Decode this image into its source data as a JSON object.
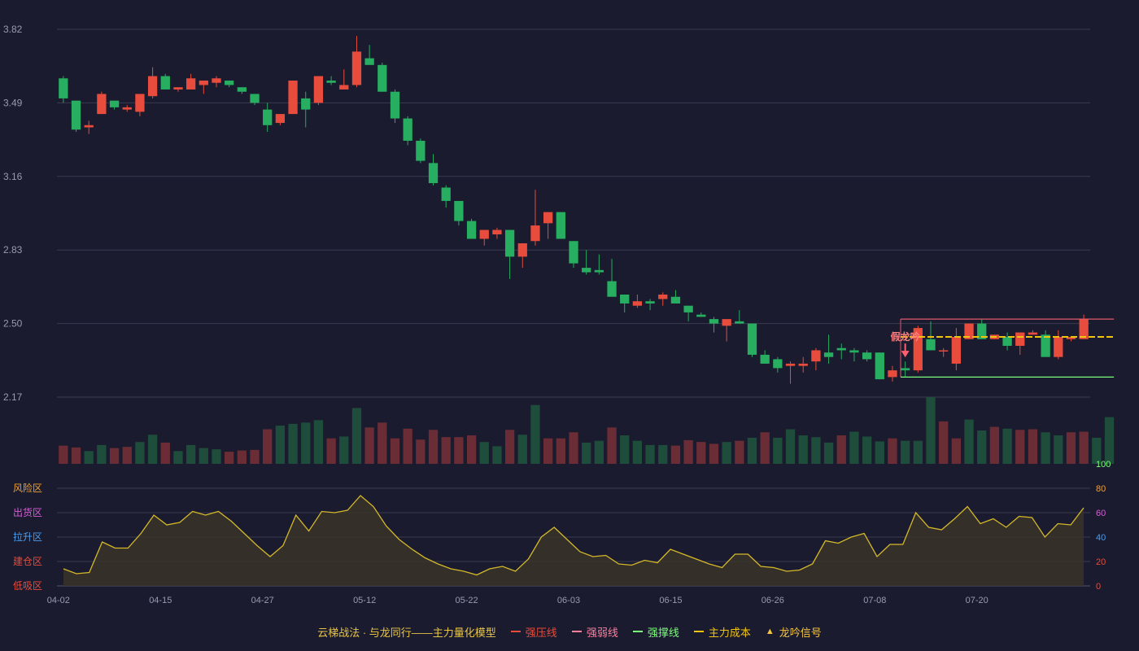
{
  "legend": {
    "title": "云梯战法 · 与龙同行——主力量化模型",
    "items": [
      {
        "label": "强压线",
        "color": "#e74c3c",
        "style": "solid"
      },
      {
        "label": "强弱线",
        "color": "#ff7f9e",
        "style": "dashed"
      },
      {
        "label": "强撑线",
        "color": "#7cfc7c",
        "style": "solid"
      },
      {
        "label": "主力成本",
        "color": "#f1c40f",
        "style": "dashed"
      },
      {
        "label": "龙吟信号",
        "color": "#f5c542",
        "style": "triangle",
        "glyph": "▲"
      }
    ]
  },
  "colors": {
    "background": "#1a1b2e",
    "grid": "#3a3b50",
    "up": "#e74c3c",
    "down": "#27ae60",
    "up_volume": "#6b2d35",
    "down_volume": "#1f4d3c",
    "indicator_line": "#d4b82a",
    "indicator_fill": "#3a3428"
  },
  "chart_data": [
    {
      "type": "candlestick",
      "y_ticks": [
        "3.82",
        "3.49",
        "3.16",
        "2.83",
        "2.50",
        "2.17"
      ],
      "ylim": [
        2.17,
        3.82
      ],
      "x_tick_labels": [
        {
          "index": 0,
          "label": "04-02"
        },
        {
          "index": 8,
          "label": "04-15"
        },
        {
          "index": 16,
          "label": "04-27"
        },
        {
          "index": 24,
          "label": "05-12"
        },
        {
          "index": 32,
          "label": "05-22"
        },
        {
          "index": 40,
          "label": "06-03"
        },
        {
          "index": 48,
          "label": "06-15"
        },
        {
          "index": 56,
          "label": "06-26"
        },
        {
          "index": 64,
          "label": "07-08"
        },
        {
          "index": 72,
          "label": "07-20"
        }
      ],
      "ohlc": [
        [
          3.6,
          3.61,
          3.49,
          3.51
        ],
        [
          3.5,
          3.5,
          3.36,
          3.37
        ],
        [
          3.38,
          3.41,
          3.35,
          3.39
        ],
        [
          3.44,
          3.54,
          3.44,
          3.53
        ],
        [
          3.5,
          3.5,
          3.46,
          3.47
        ],
        [
          3.46,
          3.48,
          3.45,
          3.47
        ],
        [
          3.45,
          3.53,
          3.43,
          3.53
        ],
        [
          3.52,
          3.65,
          3.51,
          3.61
        ],
        [
          3.61,
          3.62,
          3.55,
          3.55
        ],
        [
          3.55,
          3.56,
          3.54,
          3.56
        ],
        [
          3.55,
          3.62,
          3.55,
          3.6
        ],
        [
          3.57,
          3.59,
          3.53,
          3.59
        ],
        [
          3.58,
          3.61,
          3.56,
          3.6
        ],
        [
          3.59,
          3.59,
          3.56,
          3.57
        ],
        [
          3.56,
          3.56,
          3.53,
          3.54
        ],
        [
          3.53,
          3.53,
          3.48,
          3.49
        ],
        [
          3.46,
          3.49,
          3.36,
          3.39
        ],
        [
          3.4,
          3.43,
          3.39,
          3.44
        ],
        [
          3.44,
          3.56,
          3.44,
          3.59
        ],
        [
          3.51,
          3.54,
          3.38,
          3.46
        ],
        [
          3.49,
          3.61,
          3.48,
          3.61
        ],
        [
          3.59,
          3.61,
          3.57,
          3.58
        ],
        [
          3.55,
          3.64,
          3.55,
          3.57
        ],
        [
          3.57,
          3.79,
          3.56,
          3.72
        ],
        [
          3.69,
          3.75,
          3.68,
          3.66
        ],
        [
          3.66,
          3.67,
          3.54,
          3.54
        ],
        [
          3.54,
          3.55,
          3.4,
          3.42
        ],
        [
          3.42,
          3.43,
          3.3,
          3.32
        ],
        [
          3.32,
          3.33,
          3.22,
          3.23
        ],
        [
          3.22,
          3.26,
          3.12,
          3.13
        ],
        [
          3.11,
          3.12,
          3.02,
          3.05
        ],
        [
          3.05,
          3.05,
          2.94,
          2.96
        ],
        [
          2.96,
          2.97,
          2.88,
          2.88
        ],
        [
          2.88,
          2.89,
          2.85,
          2.92
        ],
        [
          2.9,
          2.93,
          2.88,
          2.92
        ],
        [
          2.92,
          2.92,
          2.7,
          2.8
        ],
        [
          2.8,
          2.82,
          2.75,
          2.86
        ],
        [
          2.87,
          3.1,
          2.85,
          2.94
        ],
        [
          2.95,
          3.0,
          2.88,
          3.0
        ],
        [
          3.0,
          3.0,
          2.88,
          2.88
        ],
        [
          2.87,
          2.87,
          2.75,
          2.77
        ],
        [
          2.75,
          2.83,
          2.72,
          2.73
        ],
        [
          2.74,
          2.81,
          2.72,
          2.73
        ],
        [
          2.69,
          2.79,
          2.63,
          2.62
        ],
        [
          2.63,
          2.63,
          2.55,
          2.59
        ],
        [
          2.58,
          2.63,
          2.57,
          2.6
        ],
        [
          2.6,
          2.61,
          2.56,
          2.59
        ],
        [
          2.61,
          2.64,
          2.58,
          2.63
        ],
        [
          2.62,
          2.65,
          2.59,
          2.59
        ],
        [
          2.58,
          2.58,
          2.51,
          2.55
        ],
        [
          2.54,
          2.55,
          2.53,
          2.53
        ],
        [
          2.52,
          2.53,
          2.46,
          2.5
        ],
        [
          2.49,
          2.51,
          2.42,
          2.52
        ],
        [
          2.51,
          2.56,
          2.5,
          2.5
        ],
        [
          2.5,
          2.5,
          2.35,
          2.36
        ],
        [
          2.36,
          2.38,
          2.32,
          2.32
        ],
        [
          2.34,
          2.35,
          2.28,
          2.3
        ],
        [
          2.31,
          2.33,
          2.23,
          2.32
        ],
        [
          2.31,
          2.35,
          2.28,
          2.32
        ],
        [
          2.33,
          2.39,
          2.29,
          2.38
        ],
        [
          2.37,
          2.45,
          2.32,
          2.35
        ],
        [
          2.39,
          2.41,
          2.34,
          2.38
        ],
        [
          2.38,
          2.39,
          2.33,
          2.37
        ],
        [
          2.37,
          2.38,
          2.33,
          2.34
        ],
        [
          2.37,
          2.37,
          2.25,
          2.25
        ],
        [
          2.26,
          2.31,
          2.24,
          2.29
        ],
        [
          2.3,
          2.33,
          2.26,
          2.29
        ],
        [
          2.29,
          2.49,
          2.28,
          2.48
        ],
        [
          2.43,
          2.51,
          2.38,
          2.38
        ],
        [
          2.38,
          2.39,
          2.35,
          2.38
        ],
        [
          2.32,
          2.48,
          2.29,
          2.44
        ],
        [
          2.43,
          2.5,
          2.43,
          2.5
        ],
        [
          2.5,
          2.52,
          2.43,
          2.43
        ],
        [
          2.43,
          2.44,
          2.43,
          2.45
        ],
        [
          2.44,
          2.46,
          2.38,
          2.4
        ],
        [
          2.4,
          2.46,
          2.36,
          2.46
        ],
        [
          2.45,
          2.47,
          2.45,
          2.46
        ],
        [
          2.45,
          2.47,
          2.37,
          2.35
        ],
        [
          2.35,
          2.47,
          2.34,
          2.44
        ],
        [
          2.43,
          2.44,
          2.42,
          2.44
        ],
        [
          2.43,
          2.54,
          2.43,
          2.52
        ]
      ],
      "volume": [
        30,
        27,
        21,
        31,
        26,
        28,
        36,
        48,
        35,
        21,
        31,
        26,
        24,
        20,
        22,
        23,
        57,
        63,
        66,
        68,
        72,
        42,
        45,
        92,
        60,
        68,
        42,
        58,
        40,
        56,
        44,
        44,
        47,
        36,
        29,
        56,
        48,
        97,
        42,
        42,
        52,
        35,
        38,
        60,
        47,
        38,
        31,
        31,
        30,
        39,
        36,
        33,
        36,
        38,
        43,
        52,
        43,
        57,
        47,
        44,
        35,
        47,
        53,
        45,
        37,
        42,
        38,
        38,
        110,
        70,
        42,
        73,
        55,
        61,
        58,
        56,
        57,
        52,
        47,
        52,
        53,
        43,
        77
      ],
      "volume_colors": [
        "up",
        "up",
        "down",
        "down",
        "up",
        "up",
        "down",
        "down",
        "up",
        "down",
        "down",
        "down",
        "down",
        "up",
        "up",
        "up",
        "up",
        "down",
        "down",
        "down",
        "down",
        "up",
        "down",
        "down",
        "up",
        "up",
        "up",
        "up",
        "up",
        "up",
        "up",
        "up",
        "up",
        "down",
        "down",
        "up",
        "down",
        "down",
        "up",
        "up",
        "up",
        "down",
        "down",
        "up",
        "down",
        "down",
        "down",
        "down",
        "up",
        "up",
        "up",
        "up",
        "down",
        "up",
        "down",
        "up",
        "down",
        "down",
        "down",
        "down",
        "down",
        "up",
        "down",
        "down",
        "down",
        "up",
        "down",
        "down",
        "down",
        "up",
        "up",
        "down",
        "down",
        "up",
        "down",
        "up",
        "up",
        "down",
        "down",
        "up",
        "up",
        "down",
        "down"
      ],
      "annotation": {
        "label": "假龙吟",
        "index": 66
      },
      "box": {
        "start_index": 66,
        "end_index": 82,
        "upper": 2.52,
        "lower": 2.26
      },
      "cost_line": {
        "start_index": 66,
        "end_index": 82,
        "value": 2.44
      }
    },
    {
      "type": "area",
      "y_ticks": [
        "0",
        "20",
        "40",
        "60",
        "80",
        "100"
      ],
      "ylim": [
        0,
        100
      ],
      "zone_labels": [
        {
          "label": "风险区",
          "color": "#f0a030"
        },
        {
          "label": "出货区",
          "color": "#d65cd6"
        },
        {
          "label": "拉升区",
          "color": "#4a9df0"
        },
        {
          "label": "建仓区",
          "color": "#e74c3c"
        },
        {
          "label": "低吸区",
          "color": "#e74c3c"
        }
      ],
      "tick_colors": [
        "#e74c3c",
        "#e74c3c",
        "#4a9df0",
        "#d65cd6",
        "#f0a030",
        "#7cfc7c"
      ],
      "values": [
        14,
        10,
        11,
        36,
        31,
        31,
        43,
        58,
        50,
        52,
        61,
        58,
        61,
        53,
        43,
        33,
        24,
        33,
        58,
        45,
        61,
        60,
        62,
        74,
        65,
        49,
        38,
        30,
        23,
        18,
        14,
        12,
        9,
        14,
        16,
        12,
        22,
        40,
        48,
        38,
        28,
        24,
        25,
        18,
        17,
        21,
        19,
        30,
        26,
        22,
        18,
        15,
        26,
        26,
        16,
        15,
        12,
        13,
        18,
        37,
        35,
        40,
        43,
        24,
        34,
        34,
        60,
        48,
        46,
        55,
        65,
        51,
        55,
        48,
        57,
        56,
        40,
        51,
        50,
        64
      ]
    }
  ]
}
